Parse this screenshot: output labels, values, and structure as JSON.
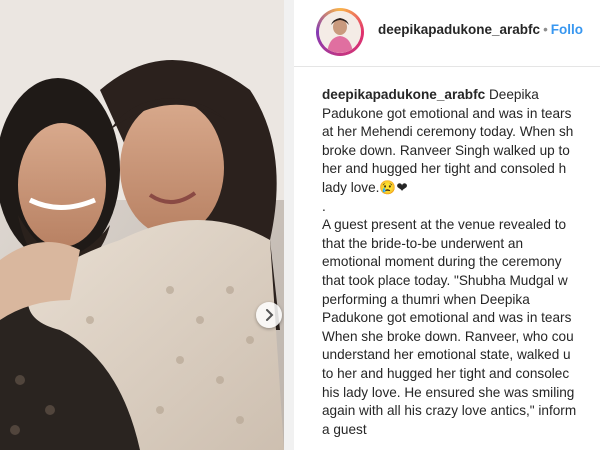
{
  "post": {
    "username": "deepikapadukone_arabfc",
    "separator": "•",
    "follow_label": "Follo"
  },
  "caption": {
    "username": "deepikapadukone_arabfc",
    "lines": [
      "Deepika",
      "Padukone got emotional and was in tears",
      "at her Mehendi ceremony today. When sh",
      "broke down. Ranveer Singh walked up to",
      "her and hugged her tight and consoled h",
      "lady love.😢❤",
      ".",
      "A guest present at the venue revealed to",
      "that the bride-to-be underwent an",
      "emotional moment during the ceremony",
      "that took place today. \"Shubha Mudgal w",
      "performing a thumri when Deepika",
      "Padukone got emotional and was in tears",
      "When she broke down. Ranveer, who cou",
      "understand her emotional state, walked u",
      "to her and hugged her tight and consolec",
      "his lady love. He ensured she was smiling",
      "again with all his crazy love antics,\" inform",
      "a guest"
    ]
  },
  "icons": {
    "carousel_next": "chevron-right-icon",
    "avatar": "profile-avatar-icon"
  },
  "colors": {
    "follow": "#3897f0",
    "text": "#262626",
    "muted": "#8e8e8e"
  }
}
